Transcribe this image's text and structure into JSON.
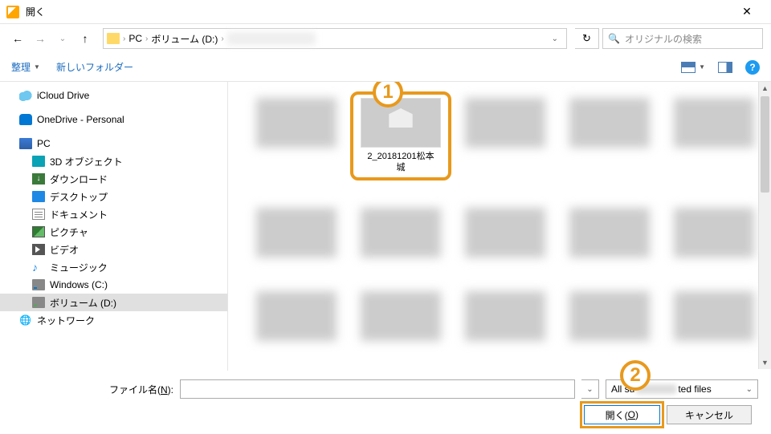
{
  "window": {
    "title": "開く"
  },
  "nav": {
    "crumbs": [
      "PC",
      "ボリューム (D:)"
    ],
    "search_placeholder": "オリジナルの検索"
  },
  "toolbar": {
    "organize": "整理",
    "new_folder": "新しいフォルダー"
  },
  "sidebar": {
    "items": [
      {
        "label": "iCloud Drive",
        "ico": "ico-cloud",
        "sub": false
      },
      {
        "label": "OneDrive - Personal",
        "ico": "ico-onedrive",
        "sub": false
      },
      {
        "label": "PC",
        "ico": "ico-pc",
        "sub": false
      },
      {
        "label": "3D オブジェクト",
        "ico": "ico-3d",
        "sub": true
      },
      {
        "label": "ダウンロード",
        "ico": "ico-downloads",
        "sub": true
      },
      {
        "label": "デスクトップ",
        "ico": "ico-desktop",
        "sub": true
      },
      {
        "label": "ドキュメント",
        "ico": "ico-docs",
        "sub": true
      },
      {
        "label": "ピクチャ",
        "ico": "ico-pics",
        "sub": true
      },
      {
        "label": "ビデオ",
        "ico": "ico-video",
        "sub": true
      },
      {
        "label": "ミュージック",
        "ico": "ico-music",
        "sub": true,
        "glyph": "♪"
      },
      {
        "label": "Windows (C:)",
        "ico": "ico-drive win",
        "sub": true
      },
      {
        "label": "ボリューム (D:)",
        "ico": "ico-drive",
        "sub": true,
        "selected": true
      },
      {
        "label": "ネットワーク",
        "ico": "ico-network",
        "sub": false,
        "glyph": "🌐"
      }
    ]
  },
  "files": {
    "selected": {
      "label": "2_20181201松本城"
    }
  },
  "footer": {
    "filename_label": "ファイル名(N):",
    "filename_label_pre": "ファイル名(",
    "filename_label_key": "N",
    "filename_label_post": "):",
    "filter_pre": "All su",
    "filter_post": "ted files",
    "open": "開く(O)",
    "open_pre": "開く(",
    "open_key": "O",
    "open_post": ")",
    "cancel": "キャンセル"
  },
  "callouts": {
    "one": "1",
    "two": "2"
  }
}
